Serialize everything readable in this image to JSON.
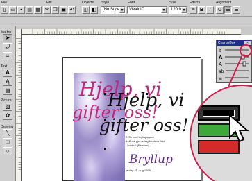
{
  "toolbar": {
    "labels": {
      "file": "File",
      "edit": "Edit",
      "objects": "Objects",
      "style": "Style",
      "font": "Font",
      "size": "Size",
      "effects": "Effects",
      "alignment": "Alignment"
    },
    "style_value": "[No Style]",
    "font_value": "VivaldiD",
    "size_value": "120.0",
    "bold": "B",
    "italic": "I",
    "underline": "U"
  },
  "palette": {
    "sections": {
      "marker": "Marker",
      "text": "Text",
      "picture": "Picture",
      "drawing": "Drawing"
    }
  },
  "chargebox": {
    "title": "ChargeBox"
  },
  "document": {
    "title_line1": "Hjelp, vi",
    "title_line2": "gifter oss!",
    "subtitle": "Bryllup",
    "date_line": "lørdag 21. aug 1999",
    "small_lines": [
      "2. Ta med bryllupsgave",
      "4. Ønsk gjerne tag brudens fest",
      "- kordsal (Elverum) -"
    ]
  },
  "colors": {
    "magenta": "#c0267a",
    "purple": "#6b2c8f",
    "zoom_outline": "#d01c4a",
    "swatch_black": "#000000",
    "swatch_green": "#3fa83a",
    "swatch_red": "#d42a2a"
  }
}
